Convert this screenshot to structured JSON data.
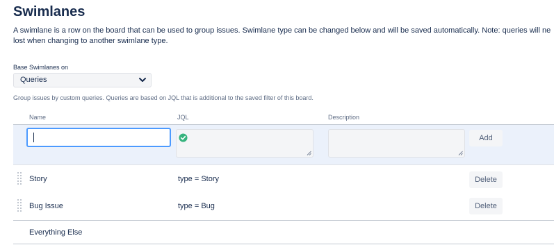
{
  "title": "Swimlanes",
  "description_line1": "A swimlane is a row on the board that can be used to group issues. Swimlane type can be changed below and will be saved automatically. Note: queries will ne",
  "description_line2": "lost when changing to another swimlane type.",
  "base_label": "Base Swimlanes on",
  "base_select": {
    "value": "Queries",
    "icon": "chevron-down-icon"
  },
  "help_text": "Group issues by custom queries. Queries are based on JQL that is additional to the saved filter of this board.",
  "columns": {
    "name": "Name",
    "jql": "JQL",
    "description": "Description"
  },
  "new_row": {
    "name_value": "",
    "jql_value": "",
    "description_value": "",
    "jql_status_icon": "check-circle-icon",
    "add_label": "Add"
  },
  "rows": [
    {
      "name": "Story",
      "jql": "type = Story",
      "delete_label": "Delete"
    },
    {
      "name": "Bug Issue",
      "jql": "type = Bug",
      "delete_label": "Delete"
    }
  ],
  "everything_else": "Everything Else",
  "colors": {
    "accent": "#4c9aff",
    "success": "#36b37e",
    "row_highlight": "#ebf1fb"
  }
}
